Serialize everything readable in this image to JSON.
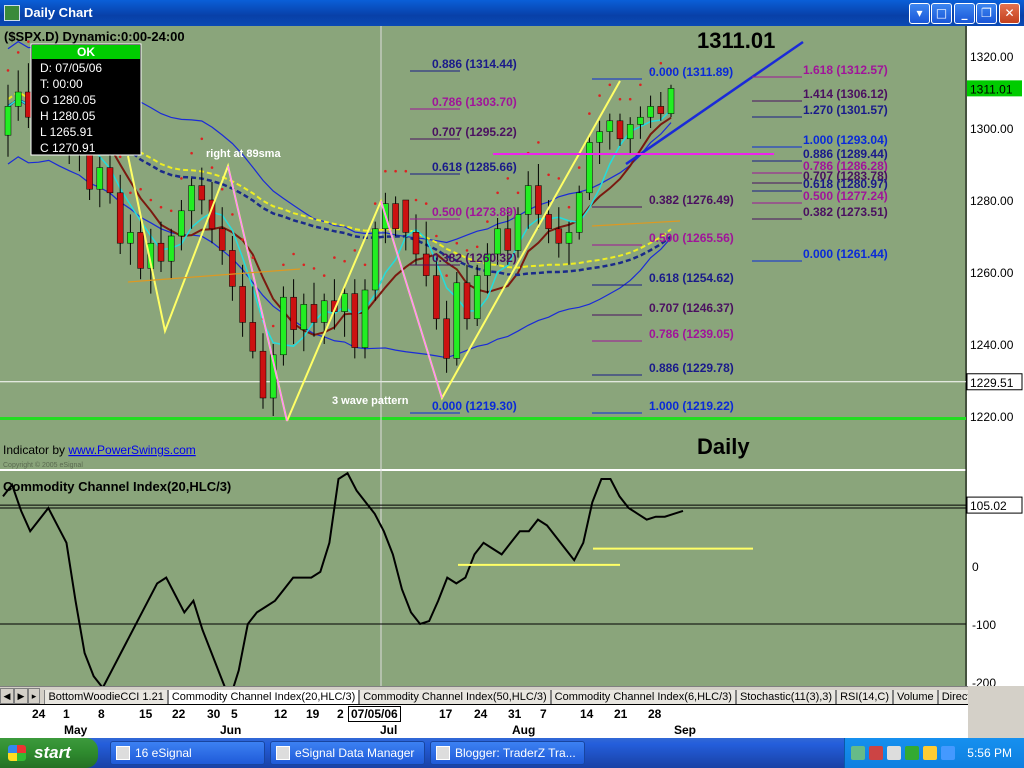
{
  "window": {
    "title": "Daily Chart"
  },
  "chart_header": {
    "symbol_line": "($SPX.D) Dynamic:0:00-24:00",
    "big_price": "1311.01",
    "timeframe": "Daily"
  },
  "data_window": {
    "status": "OK",
    "date": "D: 07/05/06",
    "time": "T: 00:00",
    "open": "O 1280.05",
    "high": "H 1280.05",
    "low": "L 1265.91",
    "close": "C 1270.91"
  },
  "indicator_credit": {
    "prefix": "Indicator by ",
    "link": "www.PowerSwings.com",
    "copyright": "Copyright © 2005 eSignal"
  },
  "annotations": {
    "sma_note": "right at 89sma",
    "wave_note": "3 wave pattern"
  },
  "cci_panel": {
    "title": "Commodity Channel Index(20,HLC/3)",
    "last_value": "105.02"
  },
  "price_axis": {
    "ticks": [
      "1320.00",
      "1300.00",
      "1280.00",
      "1260.00",
      "1240.00",
      "1220.00"
    ],
    "last_price": "1311.01",
    "crosshair_price": "1229.51"
  },
  "cci_axis": {
    "ticks": [
      "0",
      "-100",
      "-200"
    ]
  },
  "time_axis": {
    "day_labels": [
      "24",
      "1",
      "8",
      "15",
      "22",
      "30",
      "5",
      "12",
      "19",
      "2",
      "17",
      "24",
      "31",
      "7",
      "14",
      "21",
      "28"
    ],
    "month_labels": [
      "May",
      "Jun",
      "Jul",
      "Aug",
      "Sep"
    ],
    "crosshair_date": "07/05/06"
  },
  "tabs": [
    "BottomWoodieCCI 1.21",
    "Commodity Channel Index(20,HLC/3)",
    "Commodity Channel Index(50,HLC/3)",
    "Commodity Channel Index(6,HLC/3)",
    "Stochastic(11(3),3)",
    "RSI(14,C)",
    "Volume",
    "Directiona"
  ],
  "taskbar": {
    "start": "start",
    "tasks": [
      "16 eSignal",
      "eSignal Data Manager",
      "Blogger: TraderZ Tra..."
    ],
    "clock": "5:56 PM"
  },
  "chart_data": [
    {
      "type": "candlestick",
      "title": "($SPX.D) Daily",
      "ylim": [
        1210,
        1330
      ],
      "fib_levels": [
        {
          "label": "0.886 (1314.44)",
          "color": "#1a1a8a"
        },
        {
          "label": "0.786 (1303.70)",
          "color": "#a0149a"
        },
        {
          "label": "0.707 (1295.22)",
          "color": "#4a1060"
        },
        {
          "label": "0.618 (1285.66)",
          "color": "#1a1a8a"
        },
        {
          "label": "0.500 (1273.89)",
          "color": "#a0149a"
        },
        {
          "label": "0.382 (1260.32)",
          "color": "#4a1060"
        },
        {
          "label": "0.000 (1219.30)",
          "color": "#0a2ad8"
        },
        {
          "label": "0.000 (1311.89)",
          "color": "#0a2ad8"
        },
        {
          "label": "0.382 (1276.49)",
          "color": "#4a1060"
        },
        {
          "label": "0.500 (1265.56)",
          "color": "#a0149a"
        },
        {
          "label": "0.618 (1254.62)",
          "color": "#1a1a8a"
        },
        {
          "label": "0.707 (1246.37)",
          "color": "#4a1060"
        },
        {
          "label": "0.786 (1239.05)",
          "color": "#a0149a"
        },
        {
          "label": "0.886 (1229.78)",
          "color": "#1a1a8a"
        },
        {
          "label": "1.000 (1219.22)",
          "color": "#0a2ad8"
        },
        {
          "label": "1.618 (1312.57)",
          "color": "#a0149a"
        },
        {
          "label": "1.414 (1306.12)",
          "color": "#4a1060"
        },
        {
          "label": "1.270 (1301.57)",
          "color": "#1a1a8a"
        },
        {
          "label": "1.000 (1293.04)",
          "color": "#0a2ad8"
        },
        {
          "label": "0.886 (1289.44)",
          "color": "#1a1a8a"
        },
        {
          "label": "0.786 (1286.28)",
          "color": "#a0149a"
        },
        {
          "label": "0.707 (1283.78)",
          "color": "#4a1060"
        },
        {
          "label": "0.618 (1280.97)",
          "color": "#1a1a8a"
        },
        {
          "label": "0.500 (1277.24)",
          "color": "#a0149a"
        },
        {
          "label": "0.382 (1273.51)",
          "color": "#4a1060"
        },
        {
          "label": "0.000 (1261.44)",
          "color": "#0a2ad8"
        }
      ],
      "candles_ohlc": [
        [
          1298,
          1312,
          1292,
          1306
        ],
        [
          1306,
          1316,
          1302,
          1310
        ],
        [
          1310,
          1318,
          1300,
          1303
        ],
        [
          1303,
          1309,
          1295,
          1307
        ],
        [
          1307,
          1313,
          1302,
          1309
        ],
        [
          1309,
          1312,
          1295,
          1298
        ],
        [
          1298,
          1304,
          1290,
          1296
        ],
        [
          1296,
          1302,
          1288,
          1294
        ],
        [
          1294,
          1298,
          1280,
          1283
        ],
        [
          1283,
          1292,
          1278,
          1289
        ],
        [
          1289,
          1293,
          1279,
          1282
        ],
        [
          1282,
          1287,
          1265,
          1268
        ],
        [
          1268,
          1276,
          1262,
          1271
        ],
        [
          1271,
          1276,
          1258,
          1261
        ],
        [
          1261,
          1272,
          1254,
          1268
        ],
        [
          1268,
          1274,
          1260,
          1263
        ],
        [
          1263,
          1272,
          1258,
          1270
        ],
        [
          1270,
          1280,
          1266,
          1277
        ],
        [
          1277,
          1286,
          1272,
          1284
        ],
        [
          1284,
          1289,
          1276,
          1280
        ],
        [
          1280,
          1285,
          1268,
          1272
        ],
        [
          1272,
          1278,
          1262,
          1266
        ],
        [
          1266,
          1270,
          1252,
          1256
        ],
        [
          1256,
          1262,
          1242,
          1246
        ],
        [
          1246,
          1256,
          1236,
          1238
        ],
        [
          1238,
          1243,
          1222,
          1225
        ],
        [
          1225,
          1240,
          1220,
          1237
        ],
        [
          1237,
          1256,
          1234,
          1253
        ],
        [
          1253,
          1258,
          1240,
          1244
        ],
        [
          1244,
          1254,
          1238,
          1251
        ],
        [
          1251,
          1257,
          1242,
          1246
        ],
        [
          1246,
          1254,
          1240,
          1252
        ],
        [
          1252,
          1258,
          1244,
          1249
        ],
        [
          1249,
          1256,
          1242,
          1254
        ],
        [
          1254,
          1258,
          1236,
          1239
        ],
        [
          1239,
          1258,
          1236,
          1255
        ],
        [
          1255,
          1274,
          1252,
          1272
        ],
        [
          1272,
          1282,
          1268,
          1279
        ],
        [
          1279,
          1281,
          1270,
          1272
        ],
        [
          1280,
          1280,
          1266,
          1271
        ],
        [
          1271,
          1276,
          1262,
          1265
        ],
        [
          1265,
          1274,
          1256,
          1259
        ],
        [
          1259,
          1264,
          1244,
          1247
        ],
        [
          1247,
          1252,
          1232,
          1236
        ],
        [
          1236,
          1260,
          1234,
          1257
        ],
        [
          1257,
          1262,
          1244,
          1247
        ],
        [
          1247,
          1262,
          1245,
          1259
        ],
        [
          1259,
          1268,
          1254,
          1265
        ],
        [
          1265,
          1275,
          1262,
          1272
        ],
        [
          1272,
          1278,
          1262,
          1266
        ],
        [
          1266,
          1278,
          1264,
          1276
        ],
        [
          1276,
          1288,
          1272,
          1284
        ],
        [
          1284,
          1290,
          1272,
          1276
        ],
        [
          1276,
          1280,
          1268,
          1272
        ],
        [
          1272,
          1278,
          1264,
          1268
        ],
        [
          1268,
          1274,
          1262,
          1271
        ],
        [
          1271,
          1284,
          1269,
          1282
        ],
        [
          1282,
          1298,
          1280,
          1296
        ],
        [
          1296,
          1302,
          1290,
          1299
        ],
        [
          1299,
          1304,
          1294,
          1302
        ],
        [
          1302,
          1304,
          1295,
          1297
        ],
        [
          1297,
          1303,
          1293,
          1301
        ],
        [
          1301,
          1306,
          1297,
          1303
        ],
        [
          1303,
          1309,
          1300,
          1306
        ],
        [
          1306,
          1310,
          1302,
          1304
        ],
        [
          1304,
          1312,
          1303,
          1311
        ]
      ]
    },
    {
      "type": "line",
      "title": "Commodity Channel Index(20,HLC/3)",
      "ylim": [
        -230,
        200
      ],
      "series": [
        {
          "values": [
            120,
            140,
            95,
            60,
            80,
            100,
            70,
            40,
            -60,
            -150,
            -190,
            -210,
            -180,
            -150,
            -120,
            -90,
            -60,
            -30,
            -20,
            -50,
            -80,
            -60,
            -110,
            -150,
            -190,
            -230,
            -180,
            -100,
            -80,
            -70,
            -60,
            -40,
            -20,
            -20,
            -20,
            -10,
            40,
            150,
            160,
            130,
            110,
            90,
            60,
            20,
            -40,
            -80,
            -100,
            -95,
            -60,
            -20,
            -30,
            -20,
            20,
            40,
            30,
            20,
            40,
            60,
            60,
            80,
            70,
            50,
            30,
            10,
            40,
            110,
            150,
            150,
            120,
            100,
            90,
            80,
            85,
            85,
            90,
            95
          ]
        }
      ]
    }
  ]
}
